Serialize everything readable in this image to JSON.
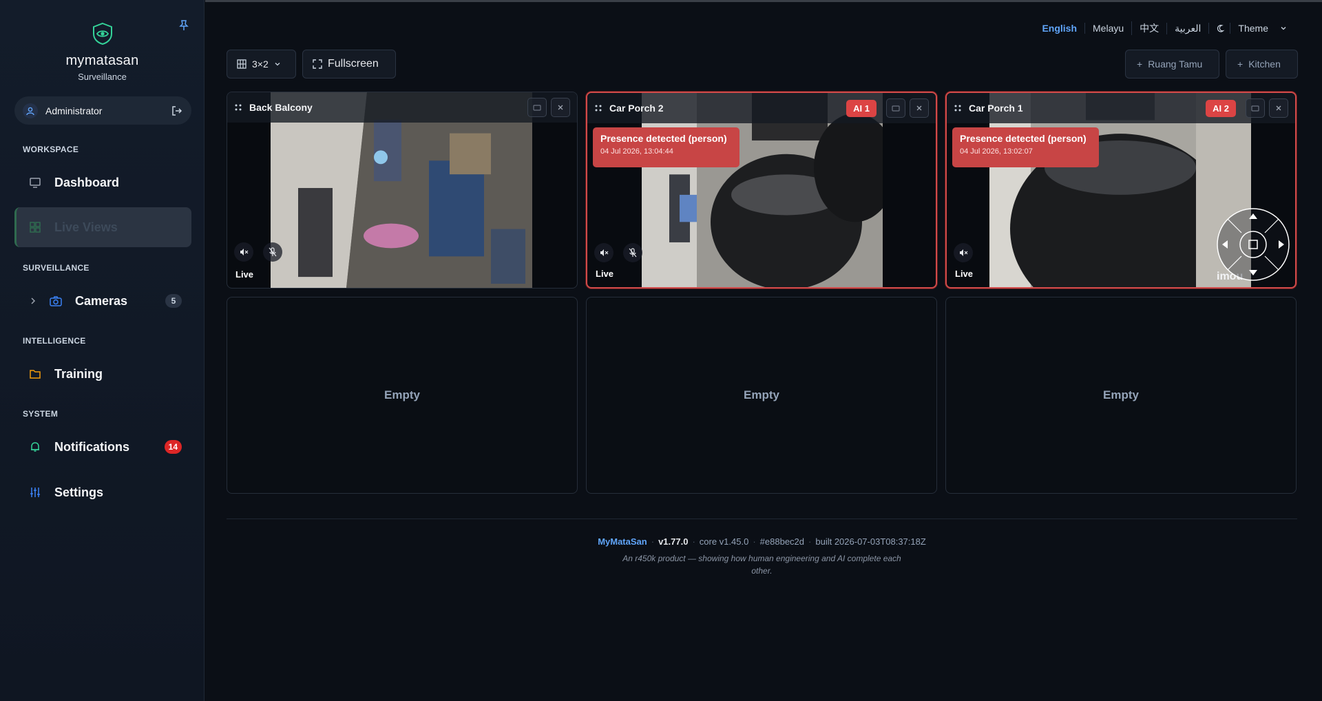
{
  "app": {
    "name": "mymatasan",
    "subtitle": "Surveillance"
  },
  "user": {
    "name": "Administrator"
  },
  "sidebar": {
    "sections": [
      "WORKSPACE",
      "SURVEILLANCE",
      "INTELLIGENCE",
      "SYSTEM"
    ],
    "items": [
      {
        "label": "Dashboard",
        "icon": "monitor-icon"
      },
      {
        "label": "Live Views",
        "icon": "grid-icon",
        "active": true
      },
      {
        "label": "Cameras",
        "icon": "camera-icon",
        "count": "5"
      },
      {
        "label": "Training",
        "icon": "folder-icon"
      },
      {
        "label": "Notifications",
        "icon": "bell-icon",
        "count": "14"
      },
      {
        "label": "Settings",
        "icon": "sliders-icon"
      }
    ]
  },
  "header": {
    "languages": [
      "English",
      "Melayu",
      "中文",
      "العربية"
    ],
    "active_language": "English",
    "theme_label": "Theme"
  },
  "toolbar": {
    "layout_label": "3×2",
    "fullscreen_label": "Fullscreen",
    "add_views": [
      "Ruang Tamu",
      "Kitchen"
    ]
  },
  "tiles": [
    {
      "title": "Back Balcony",
      "live": "Live"
    },
    {
      "title": "Car Porch 2",
      "ai_badge": "AI 1",
      "alert_title": "Presence detected (person)",
      "alert_time": "04 Jul 2026, 13:04:44",
      "live": "Live"
    },
    {
      "title": "Car Porch 1",
      "ai_badge": "AI 2",
      "alert_title": "Presence detected (person)",
      "alert_time": "04 Jul 2026, 13:02:07",
      "live": "Live",
      "watermark": "imou"
    }
  ],
  "empty_label": "Empty",
  "footer": {
    "brand": "MyMataSan",
    "version": "v1.77.0",
    "core": "core v1.45.0",
    "commit": "#e88bec2d",
    "built": "built 2026-07-03T08:37:18Z",
    "tagline": "An r450k product — showing how human engineering and AI complete each other."
  },
  "colors": {
    "accent": "#60a5fa",
    "alert": "#dc4444",
    "brand_green": "#34d399"
  }
}
